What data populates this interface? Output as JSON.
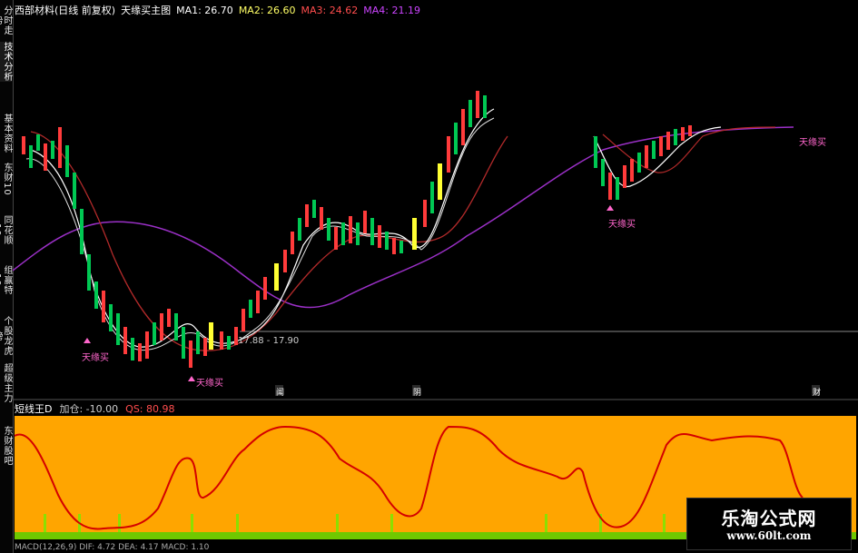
{
  "sidebar": {
    "tabs": [
      {
        "label": "分时走势",
        "active": false
      },
      {
        "label": "技术分析",
        "active": true
      },
      {
        "label": "基本资料",
        "active": false
      },
      {
        "label": "东财10",
        "active": false
      },
      {
        "label": "同花顺10",
        "active": false
      },
      {
        "label": "组赢特10",
        "active": false
      },
      {
        "label": "个股龙虎榜",
        "active": false
      },
      {
        "label": "超级主力",
        "active": false
      },
      {
        "label": "东财股吧",
        "active": false
      }
    ]
  },
  "header": {
    "stock": "西部材料(日线 前复权)",
    "indicator": "天缘买主图",
    "ma1": "MA1: 26.70",
    "ma2": "MA2: 26.60",
    "ma3": "MA3: 24.62",
    "ma4": "MA4: 21.19"
  },
  "main_chart": {
    "price_line_label": "17.88 - 17.90",
    "signals": [
      "天缘买",
      "天缘买",
      "天缘买",
      "天缘买"
    ],
    "calendar_labels": [
      "闻",
      "阴",
      "财"
    ],
    "colors": {
      "up": "#ff3b3b",
      "down": "#00c853",
      "yellow": "#ffff33",
      "ma_white": "#ffffff",
      "ma_red": "#c0392b",
      "ma_purple": "#9b30c7"
    }
  },
  "lower_panel": {
    "title": "短线王D",
    "value1": "加仓: -10.00",
    "value2": "QS: 80.98",
    "colors": {
      "background": "#ffa500",
      "line": "#d40000",
      "bars": "#8be000"
    }
  },
  "bottom_text": "MACD(12,26,9) DIF: 4.72 DEA: 4.17 MACD: 1.10",
  "watermark": {
    "title": "乐淘公式网",
    "url": "www.60lt.com"
  }
}
